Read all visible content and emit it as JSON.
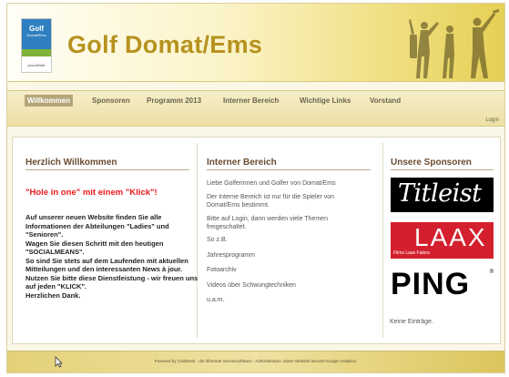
{
  "header": {
    "title": "Golf Domat/Ems",
    "logo": {
      "line1": "Golf",
      "line2": "Domat/Ems",
      "tag": "proud2ride"
    }
  },
  "nav": {
    "items": [
      "Willkommen",
      "Sponsoren",
      "Programm 2013",
      "Interner Bereich",
      "Wichtige Links",
      "Vorstand"
    ],
    "active": "Willkommen",
    "login": "Login"
  },
  "welcome": {
    "title": "Herzlich Willkommen",
    "headline": "\"Hole in one\" mit einem \"Klick\"!",
    "paragraphs": [
      "Auf unserer neuen Website finden Sie alle Informationen der Abteilungen \"Ladies\" und \"Senioren\".",
      "Wagen Sie diesen Schritt mit den heutigen \"SOCIALMEANS\".",
      "So sind Sie stets auf dem Laufenden mit aktuellen Mitteilungen und den interessanten News à jour.",
      "Nutzen Sie bitte diese Dienstleistung - wir freuen uns auf jeden \"KLICK\".",
      "Herzlichen Dank."
    ]
  },
  "internal": {
    "title": "Interner Bereich",
    "lines": [
      "Liebe Golferinnen und Golfer von Domat/Ems",
      "Der Interne Bereich ist nur für die Spieler von Domat/Ems bestimmt.",
      "Bitte auf Login, dann werden viele Themen freigeschaltet.",
      "So z.B.",
      "Jahresprogramm",
      "Fotoarchiv",
      "Videos über Schwungtechniken",
      "u.a.m."
    ]
  },
  "sponsors": {
    "title": "Unsere Sponsoren",
    "titleist": "Titleist",
    "laax": "LAAX",
    "laax_sub": "Flims Laax Falera",
    "ping": "PING",
    "ping_mark": "®",
    "empty": "Keine Einträge."
  },
  "footer": {
    "text": "Powered by ClubDesk - die führende Vereinssoftware - Administration. Diese Website benutzt Google Analytics."
  },
  "colors": {
    "title_gold": "#b6921f",
    "nav_active": "#b5a67a",
    "headline_red": "#e8191d",
    "laax_red": "#d4202e"
  }
}
